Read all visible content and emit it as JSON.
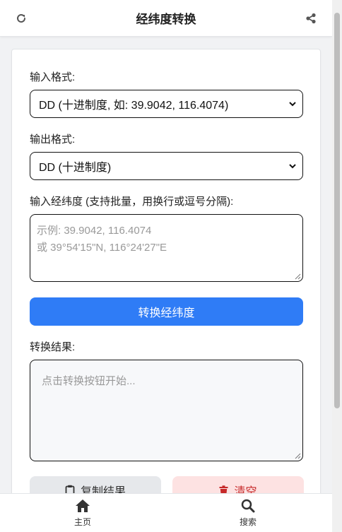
{
  "header": {
    "title": "经纬度转换",
    "refresh_icon": "refresh-icon",
    "share_icon": "share-icon"
  },
  "form": {
    "input_format_label": "输入格式:",
    "input_format_selected": "DD (十进制度, 如: 39.9042, 116.4074)",
    "output_format_label": "输出格式:",
    "output_format_selected": "DD (十进制度)",
    "coords_label": "输入经纬度 (支持批量，用换行或逗号分隔):",
    "coords_placeholder_line1": "示例: 39.9042, 116.4074",
    "coords_placeholder_line2": "或 39°54'15\"N, 116°24'27\"E",
    "convert_button": "转换经纬度",
    "result_label": "转换结果:",
    "result_placeholder": "点击转换按钮开始...",
    "copy_button": "复制结果",
    "clear_button": "清空"
  },
  "bottom_nav": {
    "items": [
      {
        "label": "主页",
        "icon": "home-icon"
      },
      {
        "label": "搜索",
        "icon": "search-icon"
      }
    ]
  },
  "colors": {
    "primary": "#2f7cf6",
    "danger_text": "#c62828",
    "danger_bg": "#fde2e2",
    "neutral_bg": "#e6e8eb"
  }
}
